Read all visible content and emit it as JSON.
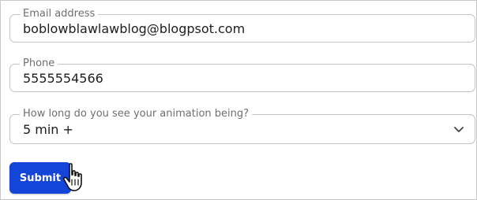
{
  "form": {
    "email": {
      "label": "Email address",
      "value": "boblowblawlawblog@blogpsot.com"
    },
    "phone": {
      "label": "Phone",
      "value": "5555554566"
    },
    "animation_length": {
      "label": "How long do you see your animation being?",
      "selected": "5 min +"
    },
    "submit_label": "Submit"
  },
  "icons": {
    "select": "chevron-down-icon",
    "cursor": "hand-pointer-cursor-icon"
  },
  "colors": {
    "accent": "#1346d8",
    "border": "#c4c4c4",
    "label": "#6f6f6f"
  }
}
